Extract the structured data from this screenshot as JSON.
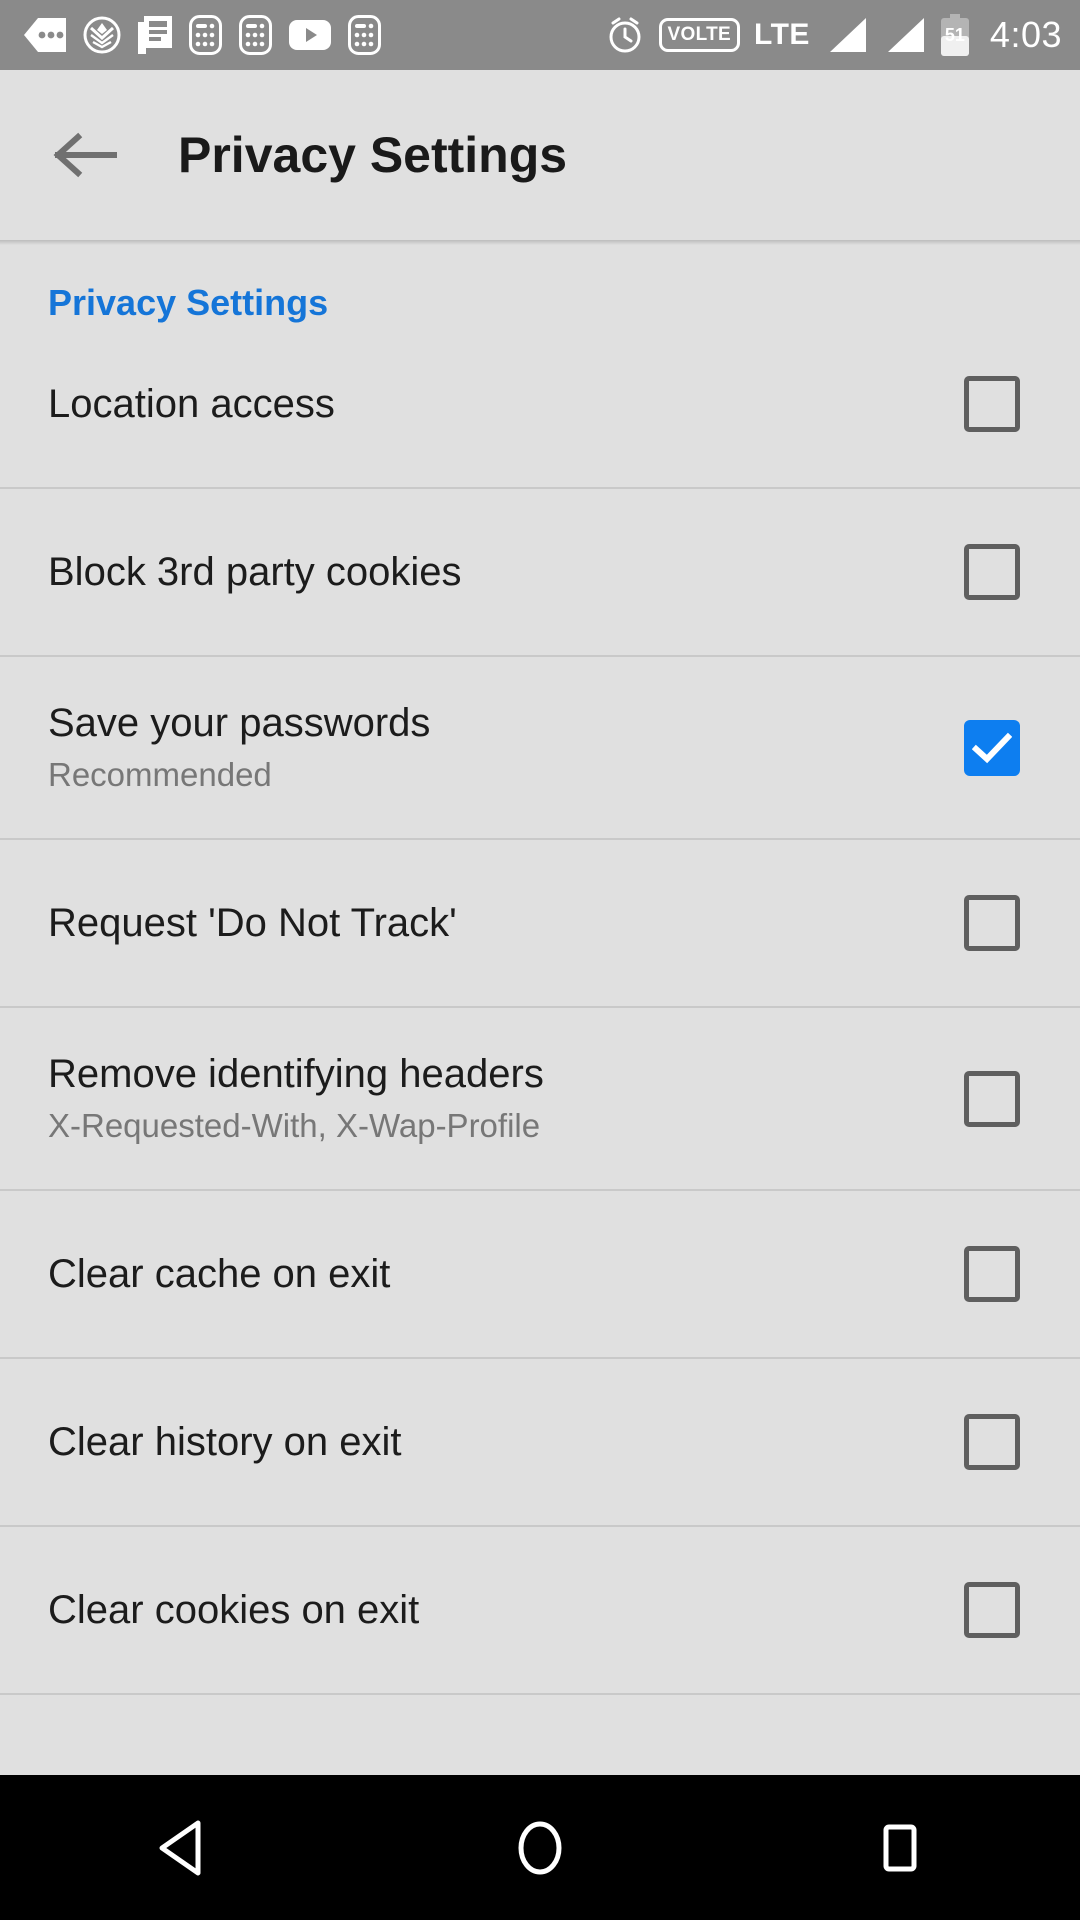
{
  "status_bar": {
    "time": "4:03",
    "battery_level": "51",
    "network_type": "LTE",
    "volte_label": "VOLTE",
    "left_icons": [
      "sim-dots-icon",
      "shield-badge-icon",
      "news-article-icon",
      "calculator-icon",
      "calculator-icon",
      "youtube-play-icon",
      "calculator-icon"
    ],
    "right_icons": [
      "alarm-clock-icon",
      "volte-badge-icon",
      "lte-label",
      "signal-bars-icon",
      "signal-bars-icon",
      "battery-icon"
    ],
    "background_color": "#8a8a8a"
  },
  "app_bar": {
    "back_label": "back-arrow",
    "title": "Privacy Settings"
  },
  "section": {
    "header": "Privacy Settings",
    "header_color": "#1575d8"
  },
  "checkbox_checked_color": "#0d7ef0",
  "rows": [
    {
      "title": "Location access",
      "subtitle": "",
      "checked": false
    },
    {
      "title": "Block 3rd party cookies",
      "subtitle": "",
      "checked": false
    },
    {
      "title": "Save your passwords",
      "subtitle": "Recommended",
      "checked": true
    },
    {
      "title": "Request 'Do Not Track'",
      "subtitle": "",
      "checked": false
    },
    {
      "title": "Remove identifying headers",
      "subtitle": "X-Requested-With, X-Wap-Profile",
      "checked": false
    },
    {
      "title": "Clear cache on exit",
      "subtitle": "",
      "checked": false
    },
    {
      "title": "Clear history on exit",
      "subtitle": "",
      "checked": false
    },
    {
      "title": "Clear cookies on exit",
      "subtitle": "",
      "checked": false
    }
  ],
  "nav_bar": {
    "buttons": [
      "back-triangle-icon",
      "home-circle-icon",
      "recents-square-icon"
    ]
  }
}
